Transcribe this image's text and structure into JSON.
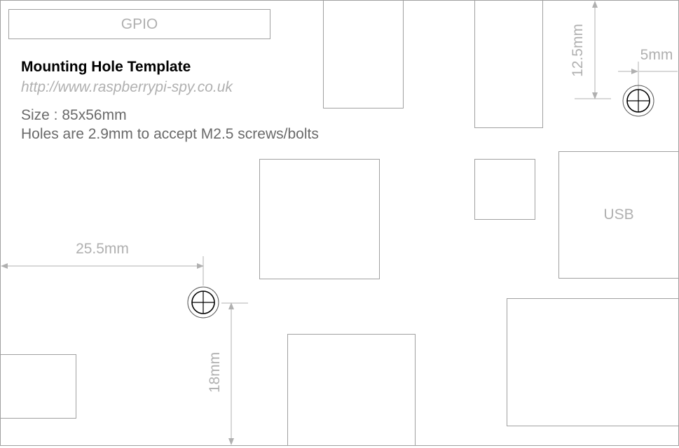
{
  "title": "Mounting Hole Template",
  "url": "http://www.raspberrypi-spy.co.uk",
  "size_text": "Size : 85x56mm",
  "holes_text": "Holes are 2.9mm to accept M2.5 screws/bolts",
  "components": {
    "gpio_label": "GPIO",
    "usb_label": "USB"
  },
  "dimensions": {
    "hole1_top_offset": "12.5mm",
    "hole1_right_offset": "5mm",
    "hole2_left_offset": "25.5mm",
    "hole2_bottom_offset": "18mm"
  },
  "colors": {
    "outline": "#a0a0a0",
    "dimension_text": "#b0b0b0",
    "hole": "#000000"
  }
}
